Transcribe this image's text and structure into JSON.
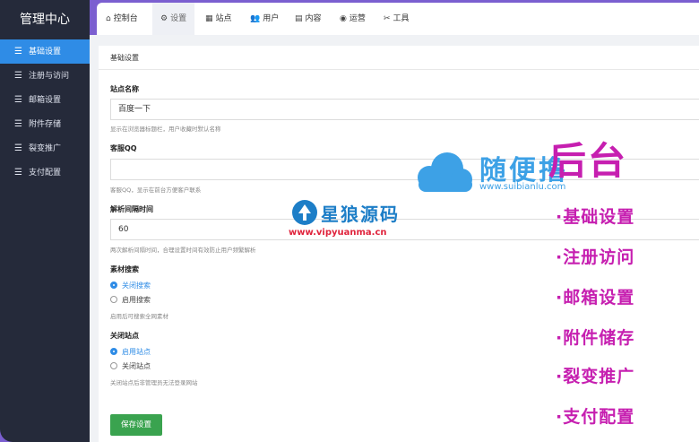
{
  "sidebar": {
    "title": "管理中心",
    "items": [
      {
        "label": "基础设置",
        "icon": "menu-lines-icon",
        "active": true
      },
      {
        "label": "注册与访问",
        "icon": "menu-lines-icon"
      },
      {
        "label": "邮箱设置",
        "icon": "menu-lines-icon"
      },
      {
        "label": "附件存储",
        "icon": "menu-lines-icon"
      },
      {
        "label": "裂变推广",
        "icon": "menu-lines-icon"
      },
      {
        "label": "支付配置",
        "icon": "menu-lines-icon"
      }
    ]
  },
  "tabs": [
    {
      "label": "控制台",
      "icon": "home-icon"
    },
    {
      "label": "设置",
      "icon": "gear-icon",
      "active": true
    },
    {
      "label": "站点",
      "icon": "grid-icon"
    },
    {
      "label": "用户",
      "icon": "users-icon"
    },
    {
      "label": "内容",
      "icon": "document-icon"
    },
    {
      "label": "运营",
      "icon": "target-icon"
    },
    {
      "label": "工具",
      "icon": "tools-icon"
    }
  ],
  "panel": {
    "title": "基础设置",
    "site_name": {
      "label": "站点名称",
      "value": "百度一下",
      "hint": "显示在浏览器标题栏，用户收藏时默认名称"
    },
    "qq": {
      "label": "客服QQ",
      "value": "",
      "hint": "客服QQ，显示在前台方便客户联系"
    },
    "interval": {
      "label": "解析间隔时间",
      "value": "60",
      "hint": "两次解析间隔时间，合理设置时间有效防止用户频繁解析"
    },
    "search": {
      "label": "素材搜索",
      "options": [
        "关闭搜索",
        "启用搜索"
      ],
      "selected": 0,
      "hint": "启用后可搜索全网素材"
    },
    "close_site": {
      "label": "关闭站点",
      "options": [
        "启用站点",
        "关闭站点"
      ],
      "selected": 0,
      "hint": "关闭站点后非管理员无法登录网站"
    },
    "save_label": "保存设置"
  },
  "overlay": {
    "title": "后台",
    "items": [
      "·基础设置",
      "·注册访问",
      "·邮箱设置",
      "·附件储存",
      "·裂变推广",
      "·支付配置"
    ],
    "suibianlu_name": "随便撸",
    "suibianlu_url": "www.suibianlu.com",
    "xinglang_name": "星狼源码",
    "xinglang_url": "www.vipyuanma.cn"
  },
  "colors": {
    "sidebar_bg": "#252a3a",
    "accent": "#2f8ce6",
    "save_button": "#3aa34f",
    "overlay_magenta": "#c61fb0",
    "outer_bg": "#7b5fd0"
  }
}
